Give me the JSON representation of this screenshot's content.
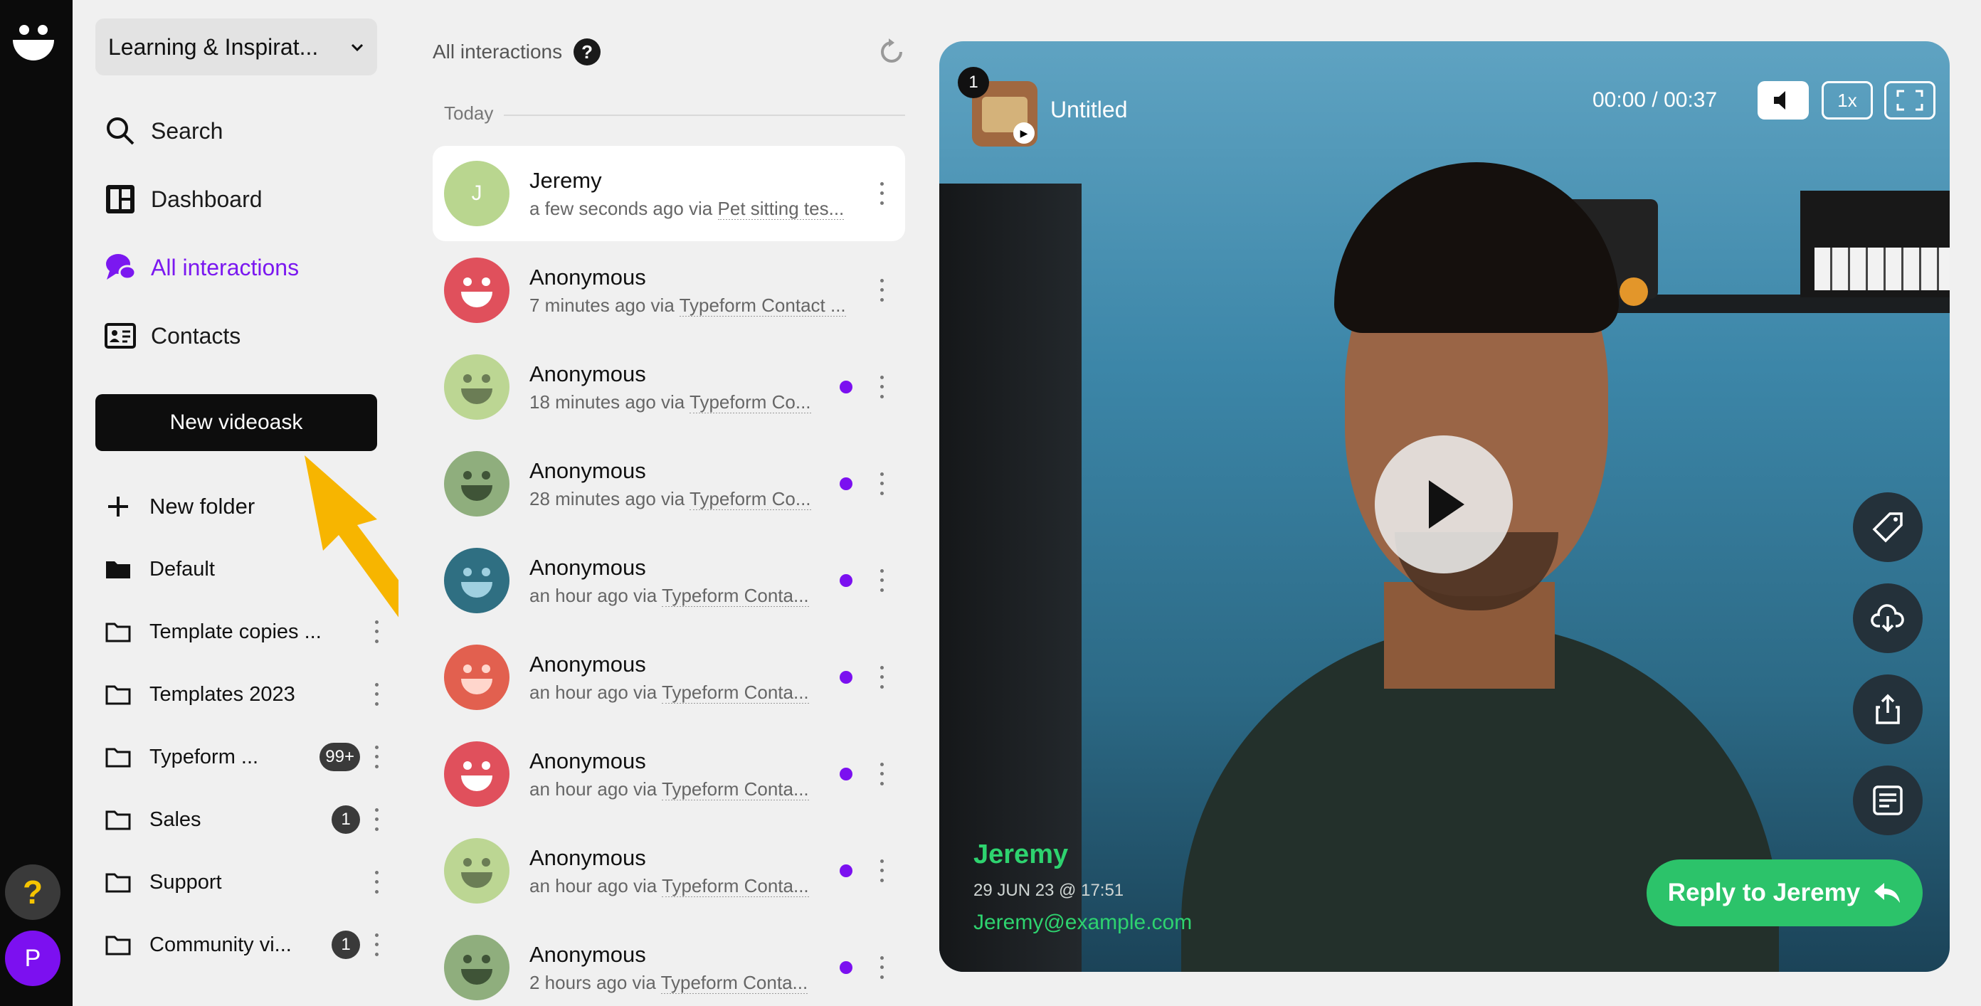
{
  "rail": {
    "help_label": "?",
    "user_initial": "P"
  },
  "sidebar": {
    "workspace": "Learning & Inspirat...",
    "nav": [
      {
        "label": "Search"
      },
      {
        "label": "Dashboard"
      },
      {
        "label": "All interactions",
        "active": true
      },
      {
        "label": "Contacts"
      }
    ],
    "new_videoask": "New videoask",
    "new_folder": "New folder",
    "folders": [
      {
        "label": "Default"
      },
      {
        "label": "Template copies ..."
      },
      {
        "label": "Templates 2023"
      },
      {
        "label": "Typeform ...",
        "badge": "99+"
      },
      {
        "label": "Sales",
        "badge": "1"
      },
      {
        "label": "Support"
      },
      {
        "label": "Community vi...",
        "badge": "1"
      }
    ]
  },
  "list": {
    "title": "All interactions",
    "help": "?",
    "section": "Today",
    "items": [
      {
        "name": "Jeremy",
        "time": "a few seconds ago via",
        "source": "Pet sitting tes...",
        "avatar": "J",
        "color": "#b9d68f",
        "unread": false
      },
      {
        "name": "Anonymous",
        "time": "7 minutes ago via",
        "source": "Typeform Contact ...",
        "color": "#e0505c",
        "unread": false
      },
      {
        "name": "Anonymous",
        "time": "18 minutes ago via",
        "source": "Typeform Co...",
        "color": "#bcd693",
        "unread": true
      },
      {
        "name": "Anonymous",
        "time": "28 minutes ago via",
        "source": "Typeform Co...",
        "color": "#8fae7d",
        "unread": true
      },
      {
        "name": "Anonymous",
        "time": "an hour ago via",
        "source": "Typeform Conta...",
        "color": "#2f6f82",
        "unread": true
      },
      {
        "name": "Anonymous",
        "time": "an hour ago via",
        "source": "Typeform Conta...",
        "color": "#e2604f",
        "unread": true
      },
      {
        "name": "Anonymous",
        "time": "an hour ago via",
        "source": "Typeform Conta...",
        "color": "#e0505c",
        "unread": true
      },
      {
        "name": "Anonymous",
        "time": "an hour ago via",
        "source": "Typeform Conta...",
        "color": "#bcd693",
        "unread": true
      },
      {
        "name": "Anonymous",
        "time": "2 hours ago via",
        "source": "Typeform Conta...",
        "color": "#8fae7d",
        "unread": true
      }
    ]
  },
  "player": {
    "count": "1",
    "title": "Untitled",
    "time": "00:00 / 00:37",
    "speed": "1x",
    "contact_name": "Jeremy",
    "date": "29 JUN 23 @ 17:51",
    "email": "Jeremy@example.com",
    "reply": "Reply to Jeremy",
    "side_actions": [
      "tag-icon",
      "download-icon",
      "share-icon",
      "transcript-icon"
    ]
  },
  "colors": {
    "accent": "#7b18f0",
    "reply": "#2cc36a",
    "annotation_arrow": "#f7b500"
  }
}
